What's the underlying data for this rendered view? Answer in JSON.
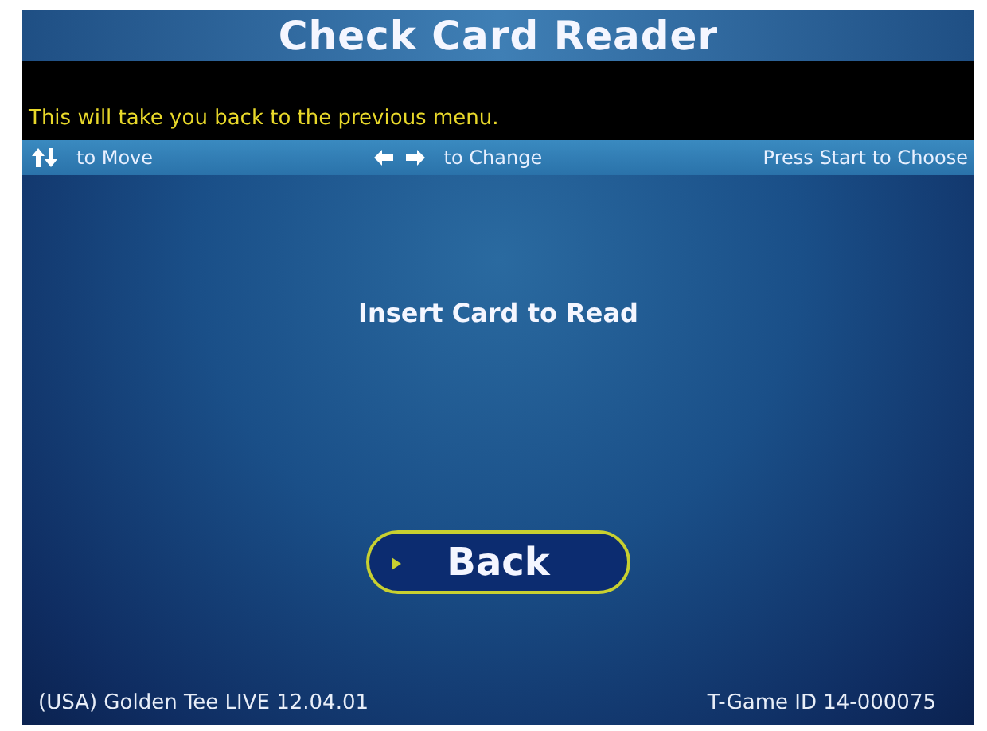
{
  "title": "Check Card Reader",
  "description": "This will take you back to the previous menu.",
  "hints": [
    {
      "kind": "updown",
      "label": "to Move"
    },
    {
      "kind": "leftright",
      "label": "to Change"
    },
    {
      "kind": "none",
      "label": "Press Start to Choose"
    }
  ],
  "message": "Insert Card to Read",
  "buttons": [
    {
      "label": "Back",
      "selected": true
    }
  ],
  "status_bar": {
    "left": "(USA) Golden Tee LIVE 12.04.01",
    "right": "T-Game ID 14-000075"
  }
}
